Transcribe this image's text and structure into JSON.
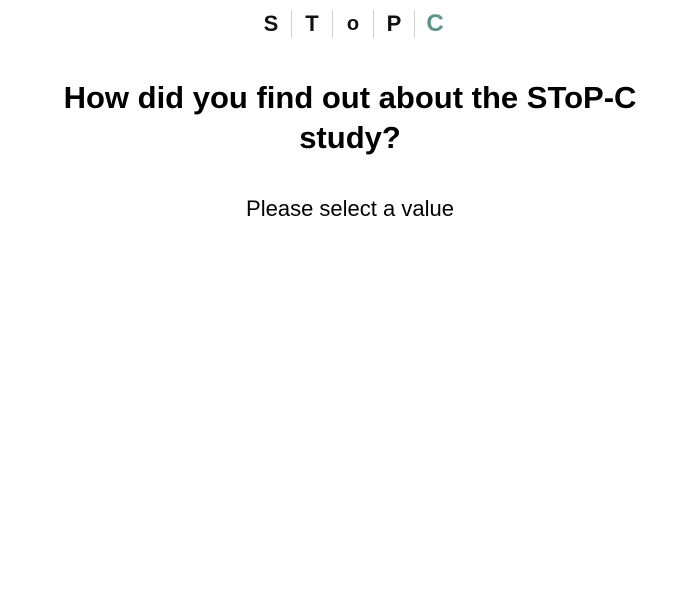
{
  "logo": {
    "letters": [
      "S",
      "T",
      "o",
      "P",
      "C"
    ],
    "accent_color": "#5b9488"
  },
  "question": {
    "title": "How did you find out about the SToP-C study?"
  },
  "prompt": {
    "text": "Please select a value"
  }
}
